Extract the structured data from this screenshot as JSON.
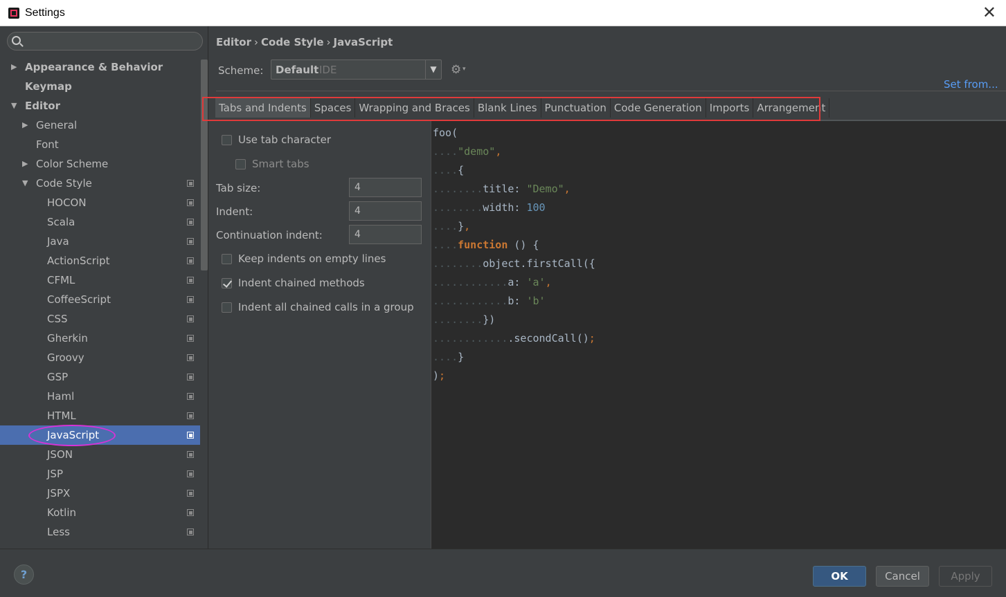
{
  "window": {
    "title": "Settings",
    "close_symbol": "✕"
  },
  "sidebar": {
    "search": {
      "placeholder": "",
      "value": ""
    },
    "items": [
      {
        "label": "Appearance & Behavior",
        "bold": true,
        "arrow": "▶",
        "level": 0
      },
      {
        "label": "Keymap",
        "bold": true,
        "arrow": "",
        "level": 0
      },
      {
        "label": "Editor",
        "bold": true,
        "arrow": "▼",
        "level": 0
      },
      {
        "label": "General",
        "arrow": "▶",
        "level": 1
      },
      {
        "label": "Font",
        "arrow": "",
        "level": 1
      },
      {
        "label": "Color Scheme",
        "arrow": "▶",
        "level": 1
      },
      {
        "label": "Code Style",
        "arrow": "▼",
        "level": 1,
        "copy": true
      },
      {
        "label": "HOCON",
        "level": 2,
        "copy": true
      },
      {
        "label": "Scala",
        "level": 2,
        "copy": true
      },
      {
        "label": "Java",
        "level": 2,
        "copy": true
      },
      {
        "label": "ActionScript",
        "level": 2,
        "copy": true
      },
      {
        "label": "CFML",
        "level": 2,
        "copy": true
      },
      {
        "label": "CoffeeScript",
        "level": 2,
        "copy": true
      },
      {
        "label": "CSS",
        "level": 2,
        "copy": true
      },
      {
        "label": "Gherkin",
        "level": 2,
        "copy": true
      },
      {
        "label": "Groovy",
        "level": 2,
        "copy": true
      },
      {
        "label": "GSP",
        "level": 2,
        "copy": true
      },
      {
        "label": "Haml",
        "level": 2,
        "copy": true
      },
      {
        "label": "HTML",
        "level": 2,
        "copy": true
      },
      {
        "label": "JavaScript",
        "level": 2,
        "copy": true,
        "selected": true
      },
      {
        "label": "JSON",
        "level": 2,
        "copy": true
      },
      {
        "label": "JSP",
        "level": 2,
        "copy": true
      },
      {
        "label": "JSPX",
        "level": 2,
        "copy": true
      },
      {
        "label": "Kotlin",
        "level": 2,
        "copy": true
      },
      {
        "label": "Less",
        "level": 2,
        "copy": true
      }
    ]
  },
  "breadcrumb": [
    "Editor",
    "Code Style",
    "JavaScript"
  ],
  "breadcrumb_sep": "›",
  "scheme": {
    "label": "Scheme:",
    "value": "Default",
    "sub": "IDE",
    "dropdown_symbol": "▼"
  },
  "set_from": "Set from...",
  "tabs": [
    {
      "label": "Tabs and Indents",
      "active": true
    },
    {
      "label": "Spaces"
    },
    {
      "label": "Wrapping and Braces"
    },
    {
      "label": "Blank Lines"
    },
    {
      "label": "Punctuation"
    },
    {
      "label": "Code Generation"
    },
    {
      "label": "Imports"
    },
    {
      "label": "Arrangement"
    }
  ],
  "options": {
    "use_tab_character": {
      "label": "Use tab character",
      "checked": false
    },
    "smart_tabs": {
      "label": "Smart tabs",
      "checked": false,
      "disabled": true
    },
    "tab_size": {
      "label": "Tab size:",
      "value": "4"
    },
    "indent": {
      "label": "Indent:",
      "value": "4"
    },
    "continuation_indent": {
      "label": "Continuation indent:",
      "value": "4"
    },
    "keep_indents_empty": {
      "label": "Keep indents on empty lines",
      "checked": false
    },
    "indent_chained_methods": {
      "label": "Indent chained methods",
      "checked": true
    },
    "indent_chained_group": {
      "label": "Indent all chained calls in a group",
      "checked": false
    }
  },
  "code_preview": [
    {
      "ws": "",
      "parts": [
        [
          "foo",
          ""
        ],
        [
          "(",
          ""
        ]
      ]
    },
    {
      "ws": "....",
      "parts": [
        [
          "\"demo\"",
          "str"
        ],
        [
          ",",
          "pun"
        ]
      ]
    },
    {
      "ws": "....",
      "parts": [
        [
          "{",
          ""
        ]
      ]
    },
    {
      "ws": "........",
      "parts": [
        [
          "title: ",
          ""
        ],
        [
          "\"Demo\"",
          "str"
        ],
        [
          ",",
          "pun"
        ]
      ]
    },
    {
      "ws": "........",
      "parts": [
        [
          "width: ",
          ""
        ],
        [
          "100",
          "num"
        ]
      ]
    },
    {
      "ws": "....",
      "parts": [
        [
          "}",
          ""
        ],
        [
          ",",
          "pun"
        ]
      ]
    },
    {
      "ws": "....",
      "parts": [
        [
          "function",
          "kw"
        ],
        [
          " () {",
          ""
        ]
      ]
    },
    {
      "ws": "........",
      "parts": [
        [
          "object.firstCall({",
          ""
        ]
      ]
    },
    {
      "ws": "............",
      "parts": [
        [
          "a: ",
          ""
        ],
        [
          "'a'",
          "str"
        ],
        [
          ",",
          "pun"
        ]
      ]
    },
    {
      "ws": "............",
      "parts": [
        [
          "b: ",
          ""
        ],
        [
          "'b'",
          "str"
        ]
      ]
    },
    {
      "ws": "........",
      "parts": [
        [
          "})",
          ""
        ]
      ]
    },
    {
      "ws": "............",
      "parts": [
        [
          ".secondCall()",
          ""
        ],
        [
          ";",
          "pun"
        ]
      ]
    },
    {
      "ws": "....",
      "parts": [
        [
          "}",
          ""
        ]
      ]
    },
    {
      "ws": "",
      "parts": [
        [
          ")",
          ""
        ],
        [
          ";",
          "pun"
        ]
      ]
    }
  ],
  "footer": {
    "help": "?",
    "ok": "OK",
    "cancel": "Cancel",
    "apply": "Apply"
  },
  "colors": {
    "accent": "#4b6eaf",
    "highlight_box": "#e03a3a",
    "selection_ellipse": "#d633d6",
    "link": "#589df6"
  },
  "icons": {
    "search": "search-icon",
    "gear": "gear-icon",
    "copy": "copy-icon",
    "help": "help-icon"
  }
}
